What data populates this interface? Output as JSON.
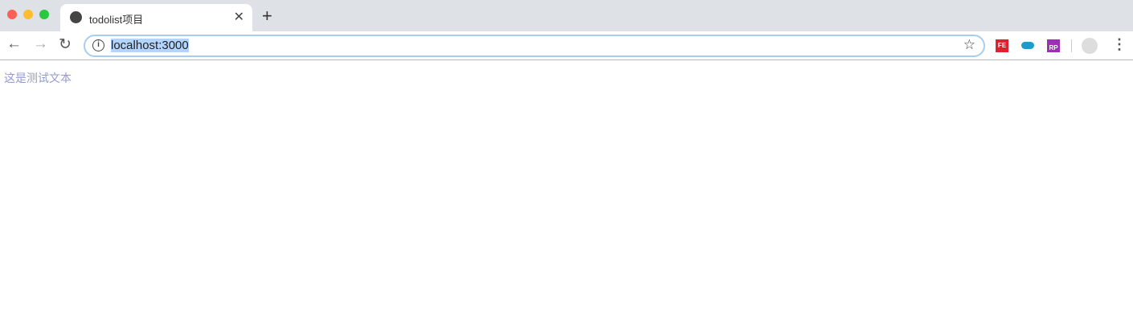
{
  "browser": {
    "tab": {
      "title": "todolist项目",
      "icon": "globe-icon"
    },
    "address": {
      "url": "localhost:3000"
    },
    "extensions": [
      {
        "name": "fe-extension",
        "label": "FE",
        "color": "#e0202e"
      },
      {
        "name": "cloud-extension",
        "color": "#1b9ccb"
      },
      {
        "name": "rp-extension",
        "label": "RP",
        "color": "#9b2fb5"
      }
    ]
  },
  "page": {
    "text": "这是测试文本",
    "text_color": "#959bd0"
  }
}
